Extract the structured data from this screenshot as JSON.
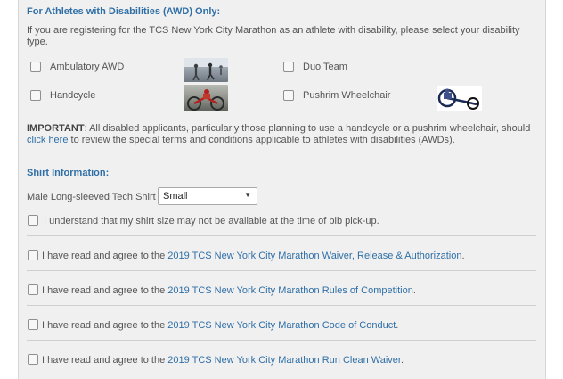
{
  "awd": {
    "heading": "For Athletes with Disabilities (AWD) Only:",
    "intro": "If you are registering for the TCS New York City Marathon as an athlete with disability, please select your disability type.",
    "options": [
      {
        "label": "Ambulatory AWD"
      },
      {
        "label": "Duo Team"
      },
      {
        "label": "Handcycle"
      },
      {
        "label": "Pushrim Wheelchair"
      }
    ],
    "important_prefix": "IMPORTANT",
    "important_text": ": All disabled applicants, particularly those planning to use a handcycle or a pushrim wheelchair, should",
    "click_here": "click here",
    "important_suffix": " to review the special terms and conditions applicable to athletes with disabilities (AWDs)."
  },
  "shirt": {
    "heading": "Shirt Information:",
    "label": "Male Long-sleeved Tech Shirt",
    "selected": "Small",
    "acknowledge": "I understand that my shirt size may not be available at the time of bib pick-up."
  },
  "agreements": {
    "prefix": "I have read and agree to the ",
    "items": [
      {
        "link": "2019 TCS New York City Marathon Waiver, Release & Authorization"
      },
      {
        "link": "2019 TCS New York City Marathon Rules of Competition"
      },
      {
        "link": "2019 TCS New York City Marathon Code of Conduct"
      },
      {
        "link": "2019 TCS New York City Marathon Run Clean Waiver"
      }
    ],
    "suffix": "."
  }
}
